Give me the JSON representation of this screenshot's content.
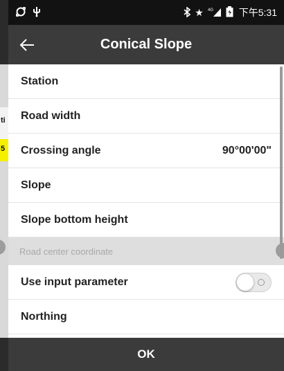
{
  "status_bar": {
    "left_icons": [
      "sync-icon",
      "usb-icon"
    ],
    "right_icons": [
      "bluetooth-icon",
      "star-icon",
      "signal-4g-icon",
      "battery-icon"
    ],
    "time": "下午5:31"
  },
  "app_bar": {
    "title": "Conical Slope",
    "back_icon": "arrow-left-icon"
  },
  "background_app": {
    "edge_text_1": "ti",
    "edge_text_2": "5"
  },
  "list": {
    "station_label": "Station",
    "road_width_label": "Road width",
    "crossing_angle_label": "Crossing angle",
    "crossing_angle_value": "90°00'00\"",
    "slope_label": "Slope",
    "slope_bottom_height_label": "Slope bottom height",
    "section_road_center": "Road center coordinate",
    "use_input_parameter_label": "Use input parameter",
    "use_input_parameter_on": false,
    "northing_label": "Northing"
  },
  "footer": {
    "ok_label": "OK"
  },
  "colors": {
    "status_bar_bg": "#121212",
    "app_bar_bg": "#3b3b3b",
    "section_bg": "#dedede",
    "accent_yellow": "#f5f000"
  }
}
